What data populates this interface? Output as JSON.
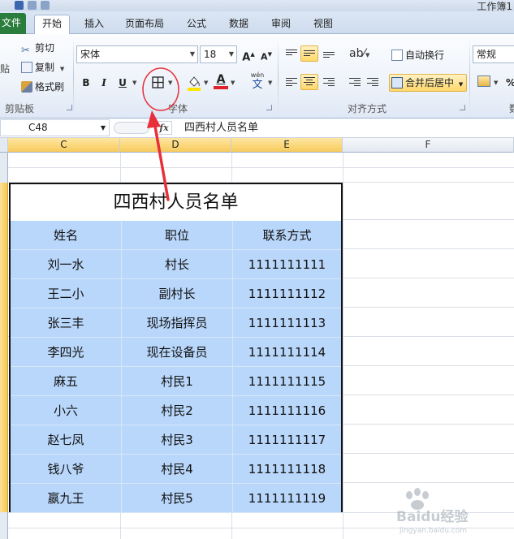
{
  "window": {
    "workbook_title": "工作簿1"
  },
  "tabs": [
    {
      "label": "文件",
      "active": false
    },
    {
      "label": "开始",
      "active": true
    },
    {
      "label": "插入",
      "active": false
    },
    {
      "label": "页面布局",
      "active": false
    },
    {
      "label": "公式",
      "active": false
    },
    {
      "label": "数据",
      "active": false
    },
    {
      "label": "审阅",
      "active": false
    },
    {
      "label": "视图",
      "active": false
    }
  ],
  "clipboard": {
    "paste_label": "贴",
    "cut": "剪切",
    "copy": "复制",
    "format_painter": "格式刷",
    "group_label": "剪贴板"
  },
  "font": {
    "font_name": "宋体",
    "font_size": "18",
    "bold": "B",
    "italic": "I",
    "underline": "U",
    "grow": "A",
    "shrink": "A",
    "font_color_letter": "A",
    "phonetic": "wén",
    "phonetic_char": "文",
    "group_label": "字体",
    "group_label_prefix": "字"
  },
  "alignment": {
    "wrap_text": "自动换行",
    "merge_center": "合并后居中",
    "group_label": "对齐方式"
  },
  "number": {
    "format": "常规",
    "percent": "%",
    "group_label_partial": "数"
  },
  "formula_bar": {
    "name_box": "C48",
    "fx": "fx",
    "content": "四西村人员名单"
  },
  "columns": [
    "C",
    "D",
    "E",
    "F"
  ],
  "sheet": {
    "title": "四西村人员名单",
    "headers": [
      "姓名",
      "职位",
      "联系方式"
    ],
    "rows": [
      [
        "刘一水",
        "村长",
        "1111111111"
      ],
      [
        "王二小",
        "副村长",
        "1111111112"
      ],
      [
        "张三丰",
        "现场指挥员",
        "1111111113"
      ],
      [
        "李四光",
        "现在设备员",
        "1111111114"
      ],
      [
        "麻五",
        "村民1",
        "1111111115"
      ],
      [
        "小六",
        "村民2",
        "1111111116"
      ],
      [
        "赵七凤",
        "村民3",
        "1111111117"
      ],
      [
        "钱八爷",
        "村民4",
        "1111111118"
      ],
      [
        "嬴九王",
        "村民5",
        "1111111119"
      ]
    ]
  },
  "watermark": {
    "text": "Baidu经验",
    "sub": "jingyan.baidu.com"
  },
  "colors": {
    "file_tab": "#2a7d3c",
    "table_fill": "#b9d7fb",
    "annotation": "#e8303a",
    "highlight": "#ffd86a"
  }
}
